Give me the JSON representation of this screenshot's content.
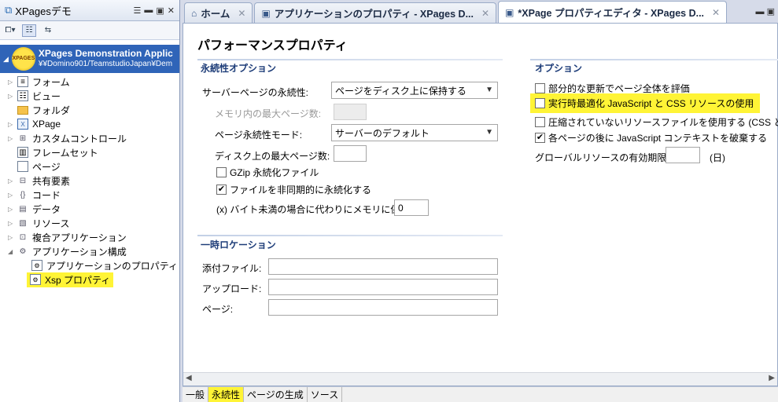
{
  "left_panel": {
    "title": "XPagesデモ",
    "db": {
      "name": "XPages Demonstration Applic",
      "path": "¥¥Domino901/TeamstudioJapan¥Dem",
      "icon_text": "XPAGES"
    },
    "tree": [
      {
        "label": "フォーム",
        "icon": "form-icon"
      },
      {
        "label": "ビュー",
        "icon": "view-icon"
      },
      {
        "label": "フォルダ",
        "icon": "folder-icon"
      },
      {
        "label": "XPage",
        "icon": "xpage-icon"
      },
      {
        "label": "カスタムコントロール",
        "icon": "custom-control-icon"
      },
      {
        "label": "フレームセット",
        "icon": "frameset-icon"
      },
      {
        "label": "ページ",
        "icon": "page-icon"
      },
      {
        "label": "共有要素",
        "icon": "shared-elements-icon"
      },
      {
        "label": "コード",
        "icon": "code-icon"
      },
      {
        "label": "データ",
        "icon": "data-icon"
      },
      {
        "label": "リソース",
        "icon": "resources-icon"
      },
      {
        "label": "複合アプリケーション",
        "icon": "composite-app-icon"
      },
      {
        "label": "アプリケーション構成",
        "icon": "app-config-icon"
      }
    ],
    "children": [
      {
        "label": "アプリケーションのプロパティ",
        "icon": "app-properties-icon"
      },
      {
        "label": "Xsp プロパティ",
        "icon": "xsp-properties-icon"
      }
    ]
  },
  "tabs": [
    {
      "label": "ホーム",
      "icon": "home-icon"
    },
    {
      "label": "アプリケーションのプロパティ - XPages D...",
      "icon": "app-properties-icon"
    },
    {
      "label": "*XPage プロパティエディタ - XPages D...",
      "icon": "xpage-editor-icon"
    }
  ],
  "editor": {
    "title": "パフォーマンスプロパティ",
    "persistence": {
      "heading": "永続性オプション",
      "server_page_label": "サーバーページの永続性:",
      "server_page_value": "ページをディスク上に保持する",
      "max_pages_memory_label": "メモリ内の最大ページ数:",
      "max_pages_memory_value": "",
      "page_mode_label": "ページ永続性モード:",
      "page_mode_value": "サーバーのデフォルト",
      "max_pages_disk_label": "ディスク上の最大ページ数:",
      "max_pages_disk_value": "",
      "gzip_label": "GZip 永続化ファイル",
      "gzip_checked": false,
      "async_label": "ファイルを非同期的に永続化する",
      "async_checked": true,
      "bytes_label": "(x) バイト未満の場合に代わりにメモリに保存:",
      "bytes_value": "0"
    },
    "temp": {
      "heading": "一時ロケーション",
      "attach_label": "添付ファイル:",
      "attach_value": "",
      "upload_label": "アップロード:",
      "upload_value": "",
      "page_label": "ページ:",
      "page_value": ""
    },
    "options": {
      "heading": "オプション",
      "partial_label": "部分的な更新でページ全体を評価",
      "partial_checked": false,
      "runtime_label": "実行時最適化 JavaScript と CSS リソースの使用",
      "runtime_checked": false,
      "uncompressed_label": "圧縮されていないリソースファイルを使用する (CSS と Dojo)",
      "uncompressed_checked": false,
      "discard_label": "各ページの後に JavaScript コンテキストを破棄する",
      "discard_checked": true,
      "expiry_label": "グローバルリソースの有効期限:",
      "expiry_value": "",
      "expiry_unit": "(日)"
    }
  },
  "bottom_tabs": [
    "一般",
    "永続性",
    "ページの生成",
    "ソース"
  ],
  "colors": {
    "highlight": "#fff436",
    "selection": "#2f64b8"
  }
}
